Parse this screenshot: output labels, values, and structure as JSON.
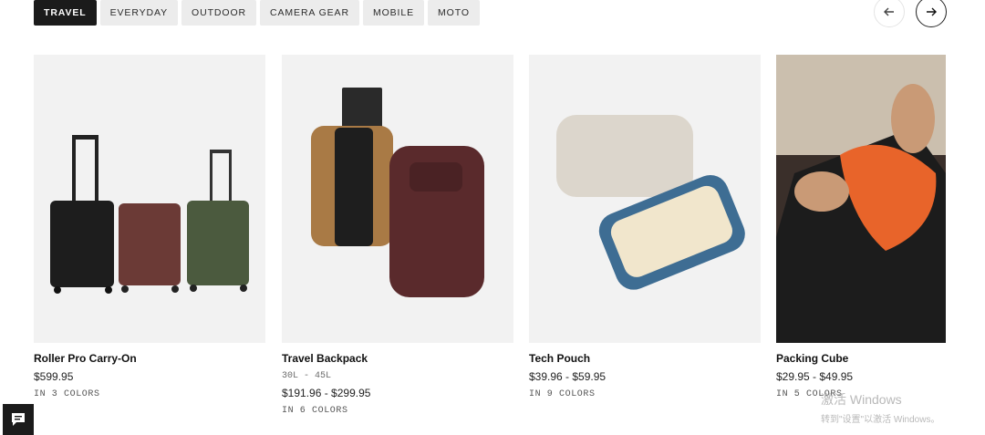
{
  "tabs": [
    "TRAVEL",
    "EVERYDAY",
    "OUTDOOR",
    "CAMERA GEAR",
    "MOBILE",
    "MOTO"
  ],
  "nav": {
    "prev_icon": "arrow-left-icon",
    "next_icon": "arrow-right-icon"
  },
  "products": [
    {
      "name": "Roller Pro Carry-On",
      "price": "$599.95",
      "colors": "IN 3 COLORS"
    },
    {
      "name": "Travel Backpack",
      "capacity": "30L - 45L",
      "price": "$191.96 - $299.95",
      "colors": "IN 6 COLORS"
    },
    {
      "name": "Tech Pouch",
      "price": "$39.96 - $59.95",
      "colors": "IN 9 COLORS"
    },
    {
      "name": "Packing Cube",
      "price": "$29.95 - $49.95",
      "colors": "IN 5 COLORS"
    }
  ],
  "chat": {
    "icon": "chat-icon"
  },
  "watermark": {
    "line1": "激活 Windows",
    "line2": "转到\"设置\"以激活 Windows。"
  },
  "colors": {
    "active_tab": "#1b1b1b",
    "tab_bg": "#ececec",
    "card_bg": "#f2f2f2"
  }
}
